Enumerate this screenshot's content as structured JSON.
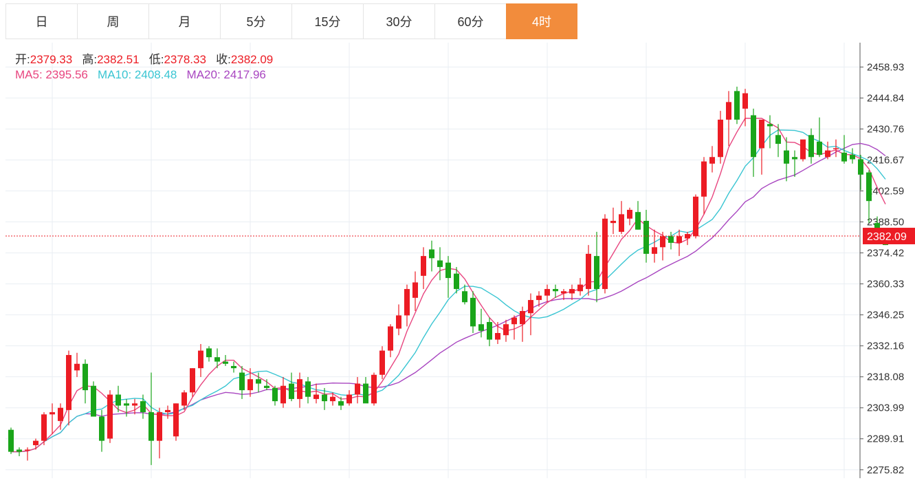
{
  "tabs": [
    {
      "label": "日",
      "active": false
    },
    {
      "label": "周",
      "active": false
    },
    {
      "label": "月",
      "active": false
    },
    {
      "label": "5分",
      "active": false
    },
    {
      "label": "15分",
      "active": false
    },
    {
      "label": "30分",
      "active": false
    },
    {
      "label": "60分",
      "active": false
    },
    {
      "label": "4时",
      "active": true
    }
  ],
  "ohlc_info": {
    "open_label": "开:",
    "open_value": "2379.33",
    "high_label": "高:",
    "high_value": "2382.51",
    "low_label": "低:",
    "low_value": "2378.33",
    "close_label": "收:",
    "close_value": "2382.09"
  },
  "ma_info": {
    "ma5_label": "MA5:",
    "ma5_value": "2395.56",
    "ma10_label": "MA10:",
    "ma10_value": "2408.48",
    "ma20_label": "MA20:",
    "ma20_value": "2417.96"
  },
  "colors": {
    "up": "#ec1c24",
    "down": "#1aa51a",
    "ma5": "#e8457f",
    "ma10": "#39c5d2",
    "ma20": "#a845c0",
    "active_tab": "#f28c3c",
    "label_text": "#333333",
    "grid": "#e9eef3"
  },
  "chart_data": {
    "type": "candlestick",
    "ylim": [
      2272,
      2470
    ],
    "y_ticks": [
      "2458.93",
      "2444.84",
      "2430.76",
      "2416.67",
      "2402.59",
      "2388.50",
      "2374.42",
      "2360.33",
      "2346.25",
      "2332.16",
      "2318.08",
      "2303.99",
      "2289.91",
      "2275.82"
    ],
    "current_price": "2382.09",
    "candles": [
      [
        2294,
        2295,
        2283,
        2284
      ],
      [
        2285,
        2286,
        2282,
        2284
      ],
      [
        2285,
        2286,
        2280,
        2285
      ],
      [
        2287,
        2290,
        2285,
        2289
      ],
      [
        2289,
        2302,
        2287,
        2301
      ],
      [
        2301,
        2306,
        2292,
        2302
      ],
      [
        2298,
        2306,
        2294,
        2304
      ],
      [
        2303,
        2330,
        2296,
        2328
      ],
      [
        2321,
        2329,
        2318,
        2324
      ],
      [
        2324,
        2326,
        2306,
        2312
      ],
      [
        2314,
        2316,
        2301,
        2300
      ],
      [
        2300,
        2303,
        2284,
        2289
      ],
      [
        2290,
        2312,
        2288,
        2310
      ],
      [
        2310,
        2314,
        2302,
        2305
      ],
      [
        2306,
        2308,
        2300,
        2305
      ],
      [
        2305,
        2308,
        2301,
        2306
      ],
      [
        2307,
        2310,
        2299,
        2302
      ],
      [
        2302,
        2320,
        2278,
        2289
      ],
      [
        2289,
        2304,
        2281,
        2302
      ],
      [
        2302,
        2305,
        2299,
        2303
      ],
      [
        2291,
        2306,
        2289,
        2306
      ],
      [
        2305,
        2312,
        2303,
        2311
      ],
      [
        2311,
        2322,
        2309,
        2322
      ],
      [
        2322,
        2333,
        2318,
        2330
      ],
      [
        2331,
        2332,
        2325,
        2327
      ],
      [
        2327,
        2331,
        2322,
        2325
      ],
      [
        2325,
        2328,
        2323,
        2324
      ],
      [
        2323,
        2325,
        2320,
        2322
      ],
      [
        2320,
        2323,
        2308,
        2312
      ],
      [
        2312,
        2322,
        2309,
        2317
      ],
      [
        2317,
        2320,
        2311,
        2315
      ],
      [
        2314,
        2317,
        2312,
        2313
      ],
      [
        2313,
        2314,
        2305,
        2307
      ],
      [
        2306,
        2318,
        2304,
        2314
      ],
      [
        2315,
        2320,
        2307,
        2308
      ],
      [
        2308,
        2320,
        2304,
        2317
      ],
      [
        2316,
        2318,
        2306,
        2309
      ],
      [
        2308,
        2315,
        2306,
        2310
      ],
      [
        2310,
        2313,
        2303,
        2307
      ],
      [
        2307,
        2311,
        2305,
        2309
      ],
      [
        2307,
        2309,
        2303,
        2305
      ],
      [
        2306,
        2312,
        2305,
        2310
      ],
      [
        2310,
        2318,
        2306,
        2315
      ],
      [
        2315,
        2318,
        2307,
        2306
      ],
      [
        2306,
        2320,
        2305,
        2319
      ],
      [
        2319,
        2332,
        2317,
        2330
      ],
      [
        2330,
        2342,
        2327,
        2341
      ],
      [
        2340,
        2351,
        2337,
        2346
      ],
      [
        2346,
        2360,
        2341,
        2358
      ],
      [
        2354,
        2366,
        2348,
        2361
      ],
      [
        2364,
        2377,
        2358,
        2373
      ],
      [
        2376,
        2380,
        2366,
        2372
      ],
      [
        2371,
        2377,
        2362,
        2368
      ],
      [
        2370,
        2373,
        2354,
        2363
      ],
      [
        2365,
        2368,
        2356,
        2358
      ],
      [
        2357,
        2360,
        2351,
        2352
      ],
      [
        2354,
        2357,
        2338,
        2341
      ],
      [
        2342,
        2349,
        2336,
        2339
      ],
      [
        2343,
        2345,
        2332,
        2335
      ],
      [
        2335,
        2343,
        2333,
        2338
      ],
      [
        2337,
        2344,
        2334,
        2342
      ],
      [
        2342,
        2346,
        2335,
        2345
      ],
      [
        2342,
        2350,
        2334,
        2348
      ],
      [
        2347,
        2356,
        2337,
        2353
      ],
      [
        2353,
        2357,
        2350,
        2355
      ],
      [
        2355,
        2360,
        2352,
        2358
      ],
      [
        2358,
        2360,
        2354,
        2357
      ],
      [
        2356,
        2358,
        2353,
        2357
      ],
      [
        2356,
        2360,
        2353,
        2358
      ],
      [
        2357,
        2363,
        2355,
        2360
      ],
      [
        2358,
        2378,
        2355,
        2374
      ],
      [
        2373,
        2384,
        2352,
        2358
      ],
      [
        2358,
        2392,
        2356,
        2390
      ],
      [
        2388,
        2395,
        2383,
        2389
      ],
      [
        2384,
        2398,
        2383,
        2392
      ],
      [
        2390,
        2395,
        2387,
        2394
      ],
      [
        2393,
        2398,
        2385,
        2385
      ],
      [
        2389,
        2394,
        2370,
        2374
      ],
      [
        2374,
        2385,
        2370,
        2377
      ],
      [
        2377,
        2384,
        2371,
        2382
      ],
      [
        2382,
        2384,
        2376,
        2379
      ],
      [
        2379,
        2385,
        2373,
        2382
      ],
      [
        2381,
        2384,
        2378,
        2383
      ],
      [
        2382,
        2401,
        2381,
        2400
      ],
      [
        2400,
        2418,
        2392,
        2416
      ],
      [
        2415,
        2423,
        2411,
        2418
      ],
      [
        2418,
        2439,
        2415,
        2435
      ],
      [
        2435,
        2448,
        2423,
        2443
      ],
      [
        2448,
        2450,
        2433,
        2435
      ],
      [
        2440,
        2449,
        2432,
        2447
      ],
      [
        2437,
        2440,
        2409,
        2418
      ],
      [
        2422,
        2434,
        2410,
        2435
      ],
      [
        2433,
        2437,
        2422,
        2432
      ],
      [
        2428,
        2433,
        2418,
        2424
      ],
      [
        2421,
        2427,
        2407,
        2415
      ],
      [
        2418,
        2421,
        2409,
        2417
      ],
      [
        2417,
        2424,
        2416,
        2426
      ],
      [
        2428,
        2431,
        2415,
        2418
      ],
      [
        2425,
        2436,
        2418,
        2419
      ],
      [
        2418,
        2425,
        2417,
        2421
      ],
      [
        2422,
        2426,
        2418,
        2422
      ],
      [
        2420,
        2428,
        2415,
        2416
      ],
      [
        2419,
        2422,
        2415,
        2417
      ],
      [
        2417,
        2419,
        2403,
        2410
      ],
      [
        2411,
        2412,
        2388,
        2398
      ],
      [
        2388,
        2391,
        2379,
        2380
      ],
      [
        2382,
        2385,
        2378,
        2378
      ]
    ]
  }
}
